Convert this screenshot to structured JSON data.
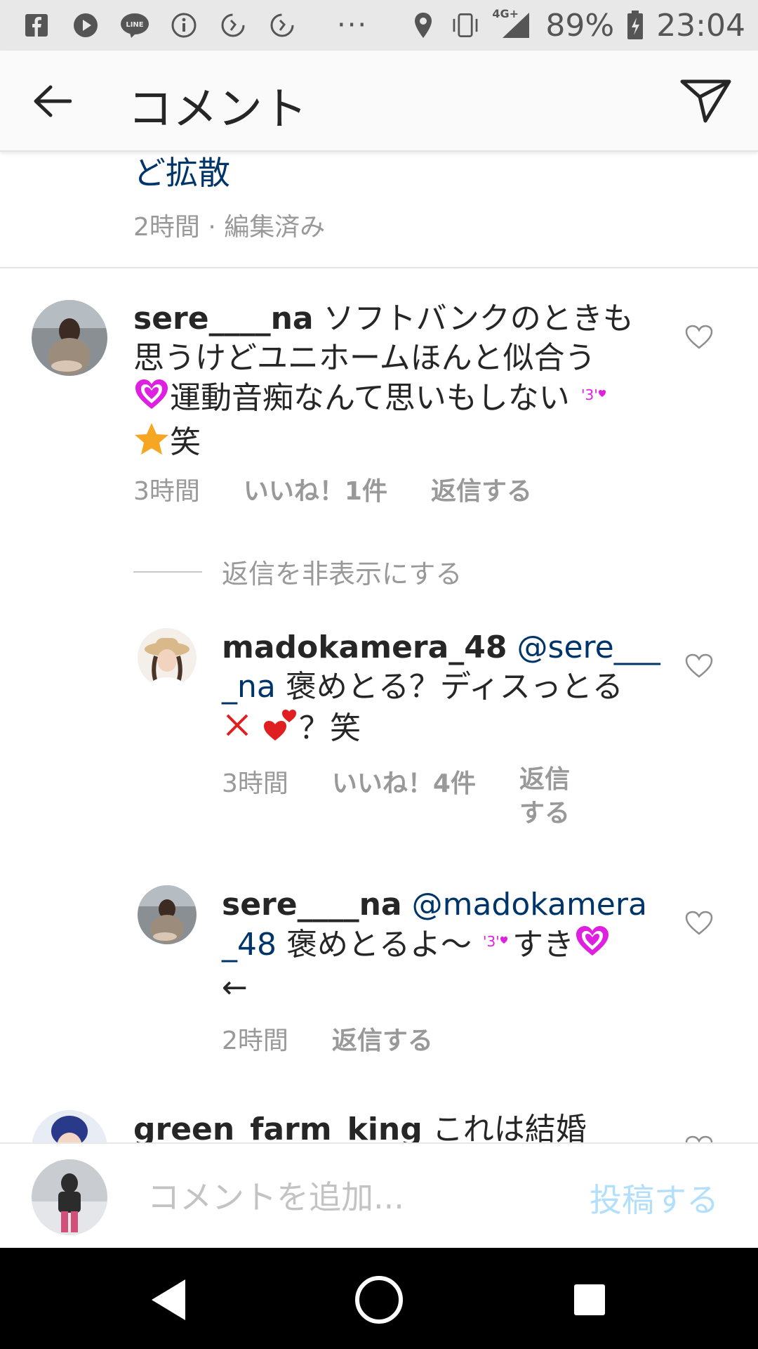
{
  "status_bar": {
    "battery": "89%",
    "time": "23:04",
    "network": "4G+",
    "icons": [
      "facebook-icon",
      "play-icon",
      "line-icon",
      "info-icon",
      "sync-icon",
      "sync-icon",
      "more-dots-icon",
      "location-icon",
      "vibrate-icon",
      "signal-icon",
      "battery-icon"
    ]
  },
  "header": {
    "title": "コメント"
  },
  "partial_comment": {
    "text": "ど拡散",
    "meta": "2時間 · 編集済み"
  },
  "comments": [
    {
      "username": "sere____na",
      "text_lines": [
        "ソフトバンクのときも",
        "思うけどユニホームほんと似合う",
        "運動音痴なんて思いもしない",
        "笑"
      ],
      "time": "3時間",
      "likes": "いいね！1件",
      "reply": "返信する"
    }
  ],
  "hide_replies": "返信を非表示にする",
  "replies": [
    {
      "username": "madokamera_48",
      "mention_a": "@sere___",
      "mention_b": "_na",
      "text_a": "褒めとる？ディスっとる",
      "text_b": "？笑",
      "time": "3時間",
      "likes": "いいね！4件",
      "reply_a": "返信",
      "reply_b": "する"
    },
    {
      "username": "sere____na",
      "mention_a": "@madokamera",
      "mention_b": "_48",
      "text_a": "褒めとるよ〜",
      "text_b": "すき",
      "text_c": "←",
      "time": "2時間",
      "reply": "返信する"
    }
  ],
  "next_comment": {
    "username": "green_farm_king",
    "text": "これは結婚"
  },
  "comment_bar": {
    "placeholder": "コメントを追加...",
    "post_label": "投稿する"
  },
  "colors": {
    "link": "#003569",
    "meta": "#999999",
    "post_disabled": "#b2dffc",
    "heart_pink": "#e020e0"
  }
}
